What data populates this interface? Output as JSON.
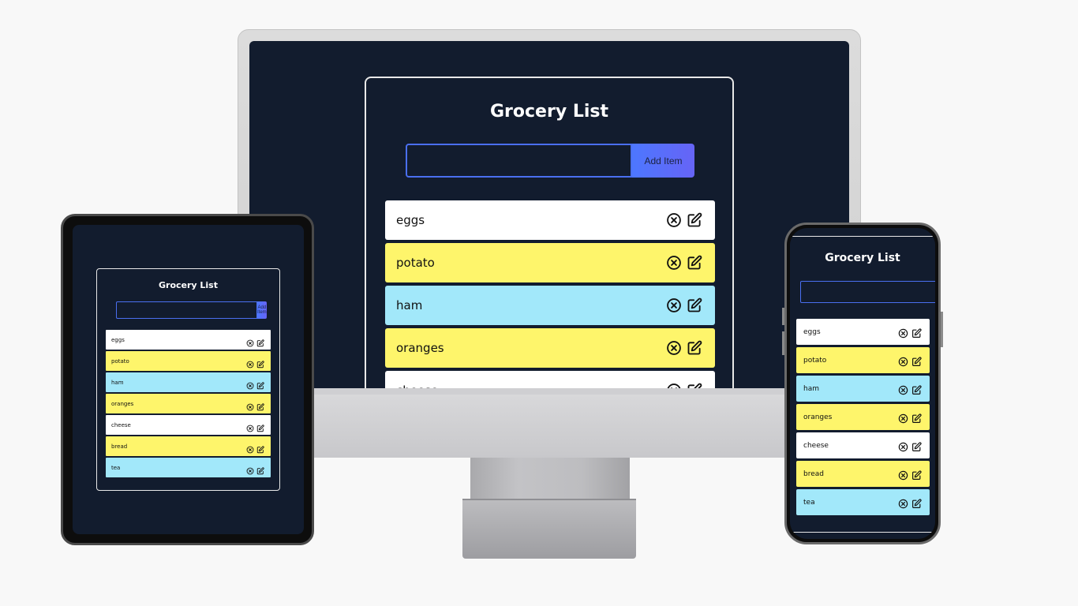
{
  "app": {
    "title": "Grocery List",
    "add_button_label": "Add Item",
    "input_value": ""
  },
  "items": [
    {
      "label": "eggs",
      "color": "white"
    },
    {
      "label": "potato",
      "color": "yellow"
    },
    {
      "label": "ham",
      "color": "blue"
    },
    {
      "label": "oranges",
      "color": "yellow"
    },
    {
      "label": "cheese",
      "color": "white"
    },
    {
      "label": "bread",
      "color": "yellow"
    },
    {
      "label": "tea",
      "color": "blue"
    }
  ],
  "icons": {
    "delete": "x-circle-icon",
    "edit": "edit-icon"
  },
  "colors": {
    "background": "#121c2e",
    "item_white": "#ffffff",
    "item_yellow": "#fef56b",
    "item_blue": "#a2e8fa",
    "accent": "#4d77ff"
  }
}
